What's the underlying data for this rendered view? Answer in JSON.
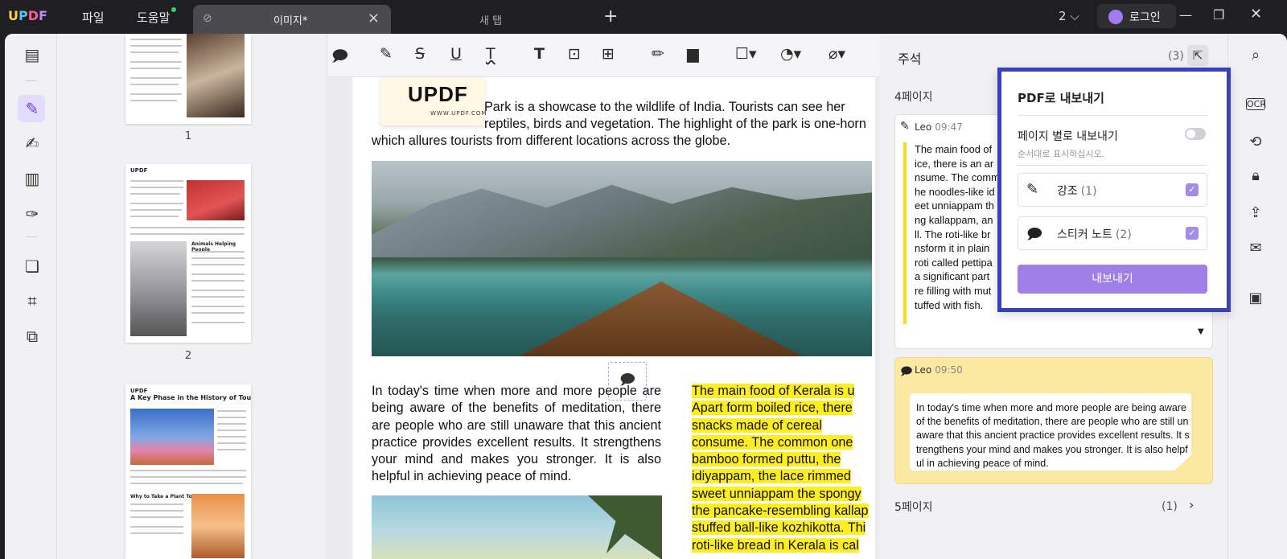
{
  "titlebar": {
    "menu_file": "파일",
    "menu_help": "도움말",
    "tab_active": "이미지*",
    "tab_new": "새 탭",
    "page_count": "2",
    "login": "로그인"
  },
  "thumbnails": {
    "pages": [
      "1",
      "2"
    ]
  },
  "document": {
    "para1": "Park is a showcase to the wildlife of India. Tourists can see her",
    "para1b": "reptiles, birds and vegetation. The highlight of the park is one-horn",
    "para1c": "which allures tourists from different locations across the globe.",
    "left_col": "In today's time when more and more people are being aware of the benefits of meditation, there are people who are still unaware that this ancient practice provides excellent results. It strengthens your mind and makes you stronger. It is also helpful in achieving peace of mind.",
    "right_col": [
      "The main food of Kerala is u",
      "Apart form boiled rice, there",
      "snacks  made  of  cereal",
      "consume. The common one",
      "bamboo  formed  puttu,  the",
      "idiyappam, the lace rimmed",
      "sweet unniappam the spongy",
      "the pancake-resembling kallap",
      "stuffed ball-like kozhikotta. Thi",
      "roti-like bread in Kerala is cal"
    ],
    "stamp_word": "UPDF",
    "stamp_url": "WWW.UPDF.COM"
  },
  "annotations": {
    "title": "주석",
    "count": "(3)",
    "page4": "4페이지",
    "page5": "5페이지",
    "page5_count": "(1)",
    "card1_user": "Leo",
    "card1_time": "09:47",
    "card1_lines": [
      "The main food of",
      "ice, there is an ar",
      "nsume. The comm",
      "he noodles-like id",
      "eet unniappam th",
      "ng kallappam, an",
      "ll. The roti-like br",
      "nsform it in plain",
      "roti called pettipa",
      "a significant part",
      "re filling with mut",
      "tuffed with fish."
    ],
    "card2_user": "Leo",
    "card2_time": "09:50",
    "card2_text": "In today's time when more and more people are being aware of the benefits of meditation, there are people who are still unaware that this ancient practice provides excellent results. It strengthens your mind and makes you stronger. It is also helpful in achieving peace of mind."
  },
  "export_popup": {
    "title": "PDF로 내보내기",
    "per_page": "페이지 별로 내보내기",
    "per_page_sub": "순서대로 표시하십시오.",
    "opt_highlight": "강조",
    "opt_highlight_count": "(1)",
    "opt_sticky": "스티커 노트",
    "opt_sticky_count": "(2)",
    "export_button": "내보내기"
  },
  "colors": {
    "accent": "#a07fe6",
    "highlight": "#ffee1f",
    "popup_border": "#3a3fbd"
  }
}
